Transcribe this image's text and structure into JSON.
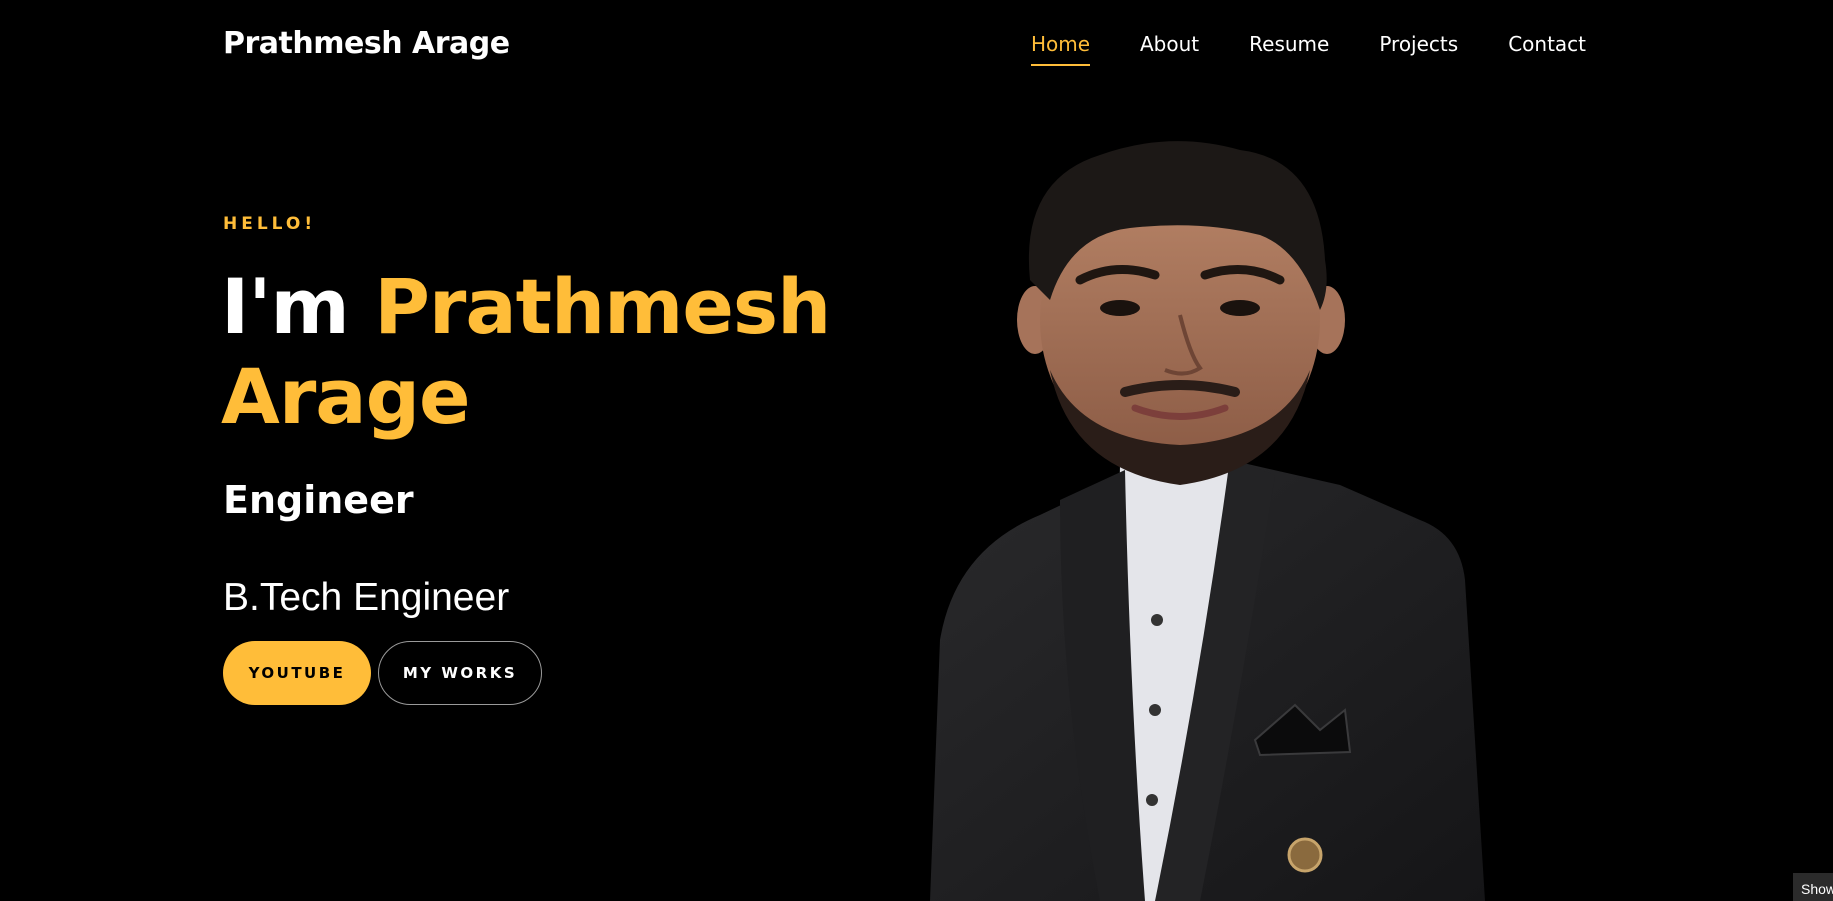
{
  "header": {
    "brand": "Prathmesh Arage",
    "nav": [
      {
        "label": "Home",
        "active": true
      },
      {
        "label": "About",
        "active": false
      },
      {
        "label": "Resume",
        "active": false
      },
      {
        "label": "Projects",
        "active": false
      },
      {
        "label": "Contact",
        "active": false
      }
    ]
  },
  "hero": {
    "greeting": "HELLO!",
    "intro": "I'm",
    "name_first": "Prathmesh",
    "name_last": "Arage",
    "role": "Engineer",
    "degree": "B.Tech Engineer",
    "buttons": {
      "primary": "YOUTUBE",
      "secondary": "MY WORKS"
    }
  },
  "corner_tab": "Show",
  "colors": {
    "accent": "#ffbd39",
    "background": "#000000",
    "text": "#ffffff"
  }
}
